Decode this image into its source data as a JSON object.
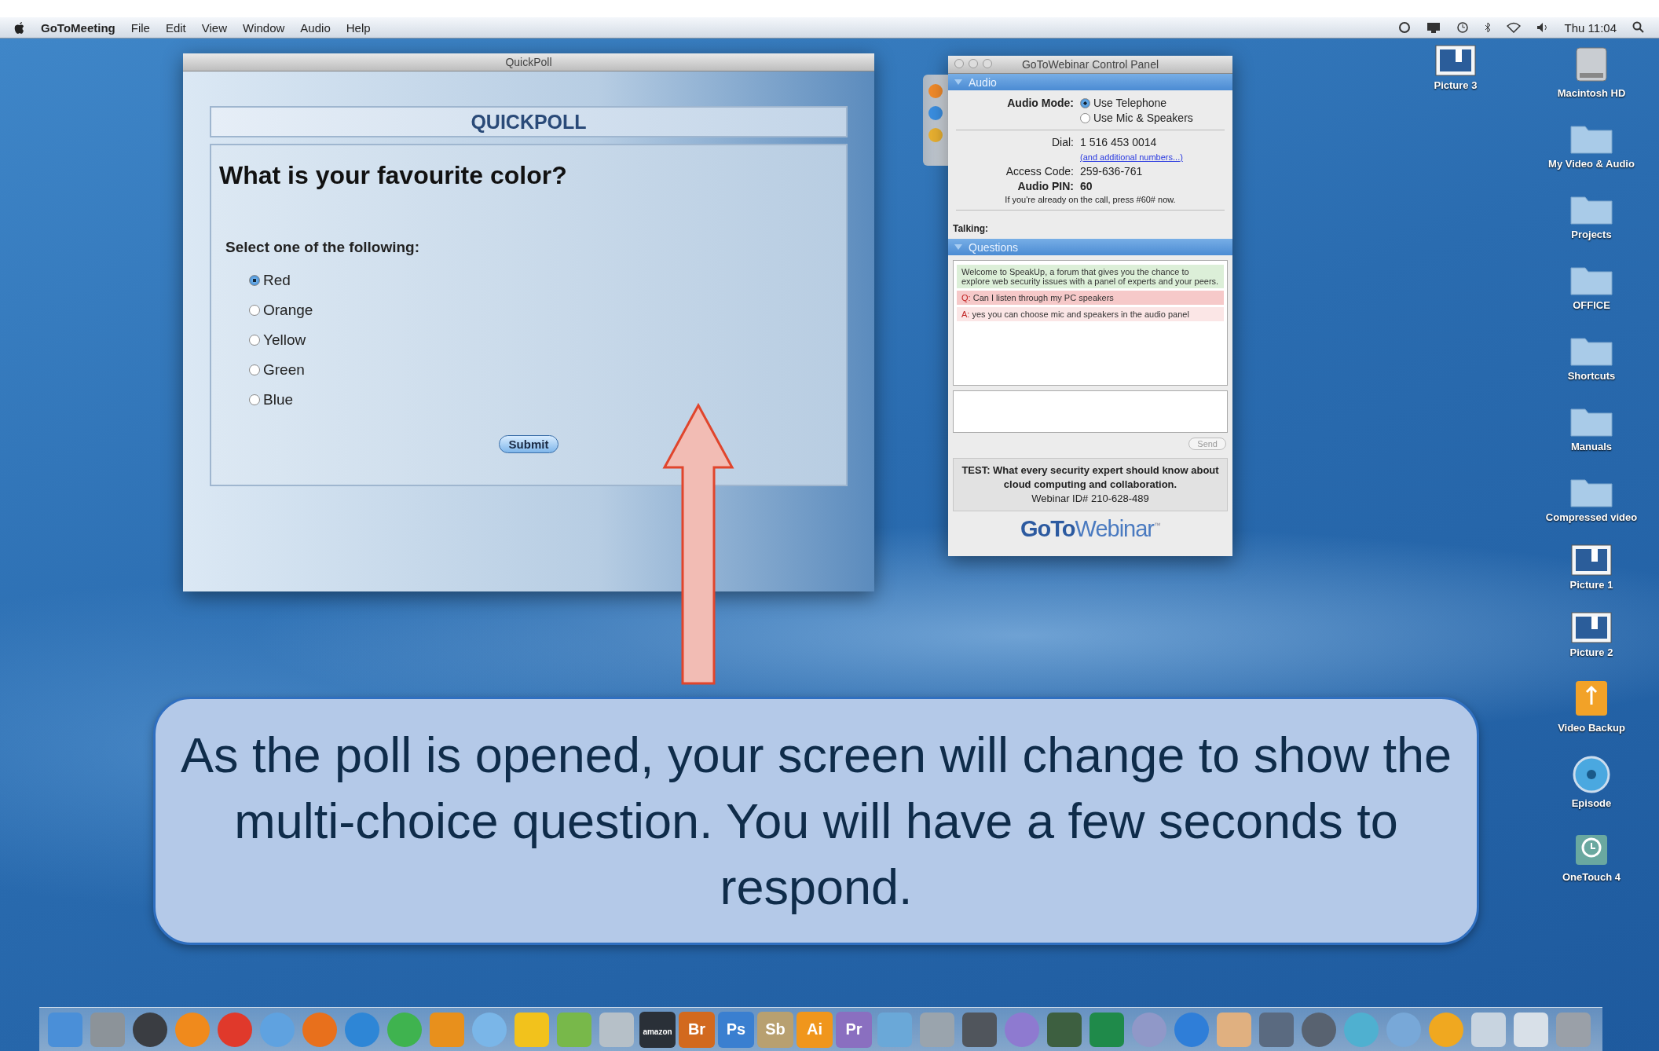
{
  "menu_bar": {
    "app_name": "GoToMeeting",
    "menus": [
      "File",
      "Edit",
      "View",
      "Window",
      "Audio",
      "Help"
    ],
    "clock": "Thu 11:04"
  },
  "quickpoll_window": {
    "title": "QuickPoll",
    "heading": "QUICKPOLL",
    "question": "What is your favourite color?",
    "instruction": "Select one of the following:",
    "options": [
      {
        "label": "Red",
        "selected": true
      },
      {
        "label": "Orange",
        "selected": false
      },
      {
        "label": "Yellow",
        "selected": false
      },
      {
        "label": "Green",
        "selected": false
      },
      {
        "label": "Blue",
        "selected": false
      }
    ],
    "submit": "Submit"
  },
  "control_panel": {
    "title": "GoToWebinar Control Panel",
    "audio": {
      "title": "Audio",
      "mode_label": "Audio Mode:",
      "modes": [
        {
          "label": "Use Telephone",
          "selected": true
        },
        {
          "label": "Use Mic & Speakers",
          "selected": false
        }
      ],
      "dial_label": "Dial:",
      "dial": "1 516 453 0014",
      "more_numbers": "(and additional numbers...)",
      "access_label": "Access Code:",
      "access_code": "259-636-761",
      "pin_label": "Audio PIN:",
      "pin": "60",
      "note": "If you're already on the call, press #60# now."
    },
    "talking_label": "Talking:",
    "questions": {
      "title": "Questions",
      "messages": [
        {
          "kind": "welcome",
          "text": "Welcome to SpeakUp, a forum that gives you the chance to explore web security issues with a panel of experts and your peers."
        },
        {
          "kind": "question",
          "prefix": "Q:",
          "text": "Can I listen through my PC speakers"
        },
        {
          "kind": "answer",
          "prefix": "A:",
          "text": "yes you can choose mic and speakers in the audio panel"
        }
      ],
      "send": "Send"
    },
    "webinar": {
      "title": "TEST: What every security expert should know about cloud computing and collaboration.",
      "id": "Webinar ID# 210-628-489"
    },
    "logo": {
      "bold": "GoTo",
      "light": "Webinar",
      "mark": "™"
    }
  },
  "desktop_top_icon": {
    "label": "Picture 3",
    "kind": "picture"
  },
  "desktop_icons": [
    {
      "label": "Macintosh HD",
      "kind": "drive"
    },
    {
      "label": "My Video & Audio",
      "kind": "folder"
    },
    {
      "label": "Projects",
      "kind": "folder"
    },
    {
      "label": "OFFICE",
      "kind": "folder"
    },
    {
      "label": "Shortcuts",
      "kind": "folder"
    },
    {
      "label": "Manuals",
      "kind": "folder"
    },
    {
      "label": "Compressed video",
      "kind": "folder"
    },
    {
      "label": "Picture 1",
      "kind": "picture"
    },
    {
      "label": "Picture 2",
      "kind": "picture"
    },
    {
      "label": "Video Backup",
      "kind": "usb"
    },
    {
      "label": "Episode",
      "kind": "disc"
    },
    {
      "label": "OneTouch 4",
      "kind": "timemachine"
    }
  ],
  "dock": [
    {
      "kind": "square",
      "color": "#4a8fd8"
    },
    {
      "kind": "square",
      "color": "#8c9399"
    },
    {
      "kind": "circle",
      "color": "#3a3d42"
    },
    {
      "kind": "circle",
      "color": "#f08a1c"
    },
    {
      "kind": "circle",
      "color": "#e0392b"
    },
    {
      "kind": "circle",
      "color": "#5fa2e0"
    },
    {
      "kind": "circle",
      "color": "#e8701c"
    },
    {
      "kind": "circle",
      "color": "#2e86d6"
    },
    {
      "kind": "circle",
      "color": "#3fb34f"
    },
    {
      "kind": "square",
      "color": "#e8901c"
    },
    {
      "kind": "circle",
      "color": "#7ab6e8"
    },
    {
      "kind": "square",
      "color": "#f2c21c"
    },
    {
      "kind": "square",
      "color": "#78b84a"
    },
    {
      "kind": "square",
      "color": "#b6c0c8"
    },
    {
      "kind": "tile",
      "label": "amazon",
      "color": "#2a3038"
    },
    {
      "kind": "tile",
      "label": "Br",
      "color": "#d2691e"
    },
    {
      "kind": "tile",
      "label": "Ps",
      "color": "#3a7fd0"
    },
    {
      "kind": "tile",
      "label": "Sb",
      "color": "#b8a070"
    },
    {
      "kind": "tile",
      "label": "Ai",
      "color": "#f0961c"
    },
    {
      "kind": "tile",
      "label": "Pr",
      "color": "#8a6fc0"
    },
    {
      "kind": "square",
      "color": "#6aa8d8"
    },
    {
      "kind": "square",
      "color": "#9aa4ad"
    },
    {
      "kind": "square",
      "color": "#50555c"
    },
    {
      "kind": "circle",
      "color": "#8e7ad0"
    },
    {
      "kind": "square",
      "color": "#3d5f40"
    },
    {
      "kind": "square",
      "color": "#1f8a4a"
    },
    {
      "kind": "circle",
      "color": "#9098c8"
    },
    {
      "kind": "circle",
      "color": "#2f7ed8"
    },
    {
      "kind": "square",
      "color": "#e0b080"
    },
    {
      "kind": "square",
      "color": "#5a6a80"
    },
    {
      "kind": "circle",
      "color": "#586270"
    },
    {
      "kind": "circle",
      "color": "#4fb0d0"
    },
    {
      "kind": "circle",
      "color": "#78a8d8"
    },
    {
      "kind": "circle",
      "color": "#f0a820"
    },
    {
      "kind": "square",
      "color": "#c8d4e0"
    },
    {
      "kind": "square",
      "color": "#d8e0e8"
    },
    {
      "kind": "square",
      "color": "#9aa0a8"
    }
  ],
  "callout": {
    "text": "As the poll is opened, your screen will change to show the multi-choice question. You will have a few seconds to respond."
  }
}
